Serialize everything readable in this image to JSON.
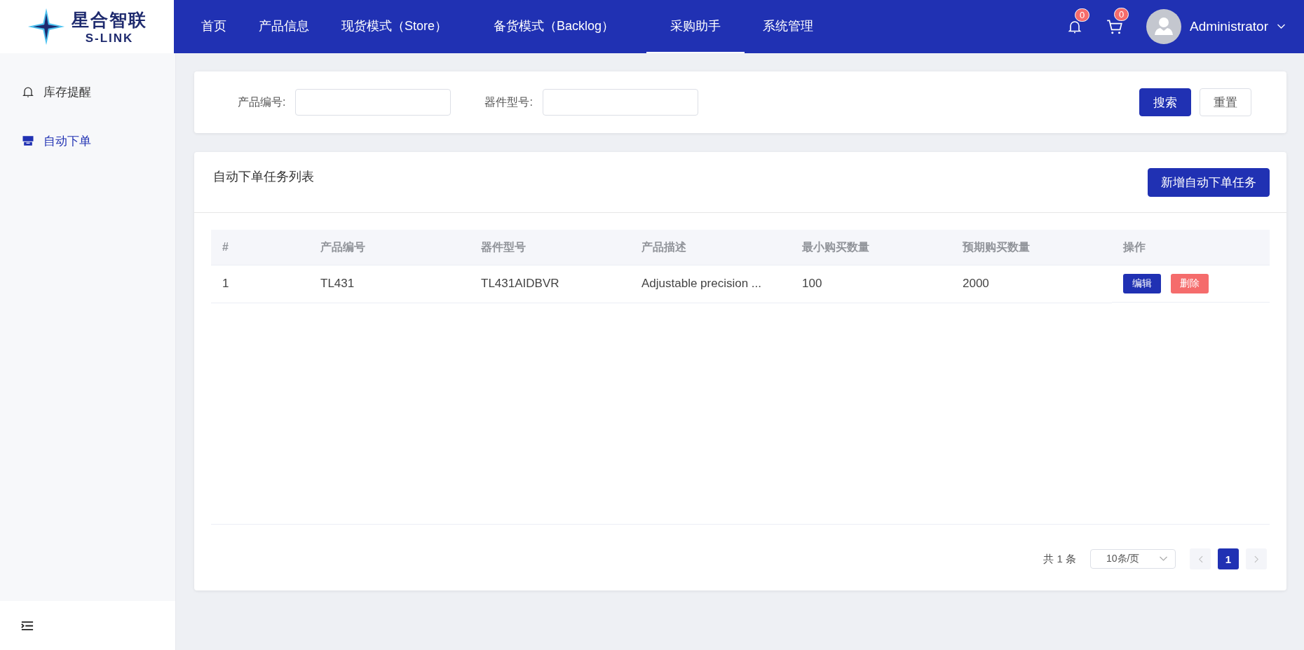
{
  "logo": {
    "name": "星合智联",
    "sub": "S-LINK"
  },
  "nav": [
    {
      "label": "首页",
      "selected": false
    },
    {
      "label": "产品信息",
      "selected": false
    },
    {
      "label": "现货模式（Store）",
      "selected": false
    },
    {
      "label": "备货模式（Backlog）",
      "selected": false
    },
    {
      "label": "采购助手",
      "selected": true
    },
    {
      "label": "系统管理",
      "selected": false
    }
  ],
  "notifications": {
    "count": "0"
  },
  "cart": {
    "count": "0"
  },
  "user": {
    "name": "Administrator"
  },
  "sidebar": {
    "items": [
      {
        "label": "库存提醒",
        "kind": "bell",
        "selected": false
      },
      {
        "label": "自动下单",
        "kind": "store",
        "selected": true
      }
    ]
  },
  "search": {
    "fields": [
      {
        "label": "产品编号:"
      },
      {
        "label": "器件型号:"
      }
    ],
    "buttons": [
      "搜索",
      "重置"
    ]
  },
  "list": {
    "title": "自动下单任务列表",
    "add_button": "新增自动下单任务",
    "columns": [
      "#",
      "产品编号",
      "器件型号",
      "产品描述",
      "最小购买数量",
      "预期购买数量",
      "操作"
    ],
    "rows": [
      {
        "cells": [
          "1",
          "TL431",
          "TL431AIDBVR",
          "Adjustable precision ...",
          "100",
          "2000"
        ],
        "actions": [
          "编辑",
          "删除"
        ]
      }
    ]
  },
  "pagination": {
    "total": "共 1 条",
    "page_size": "10条/页",
    "pages": [
      {
        "label": "1",
        "selected": true
      }
    ]
  }
}
